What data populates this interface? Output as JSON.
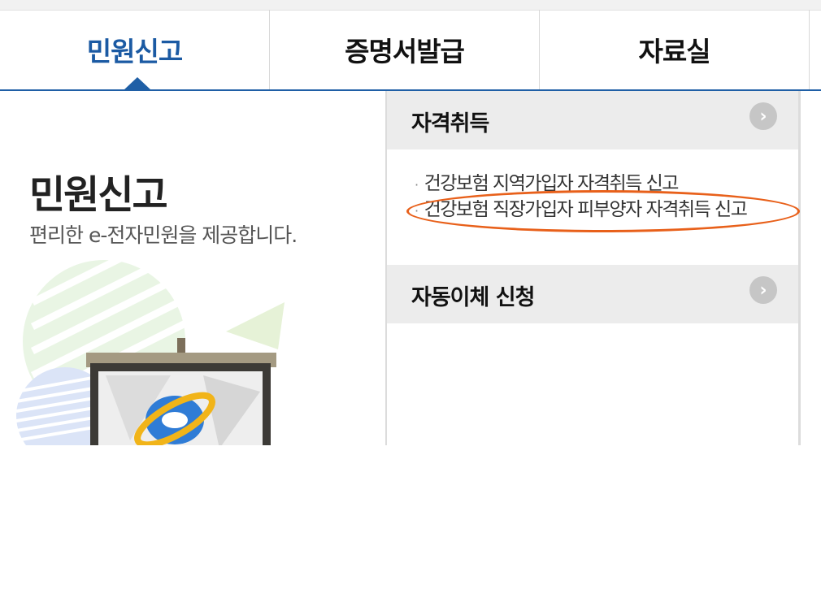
{
  "tabs": [
    {
      "label": "민원신고",
      "active": true
    },
    {
      "label": "증명서발급",
      "active": false
    },
    {
      "label": "자료실",
      "active": false
    }
  ],
  "left_panel": {
    "title": "민원신고",
    "subtitle": "편리한 e-전자민원을 제공합니다."
  },
  "sections": [
    {
      "title": "자격취득",
      "links": [
        "건강보험 지역가입자 자격취득 신고",
        "건강보험 직장가입자 피부양자 자격취득 신고"
      ]
    },
    {
      "title": "자동이체 신청",
      "links": []
    }
  ],
  "go_icon": "chevron-right-circle-icon",
  "colors": {
    "accent": "#1b5aa3",
    "highlight": "#e8601a",
    "section_bg": "#ececec"
  }
}
